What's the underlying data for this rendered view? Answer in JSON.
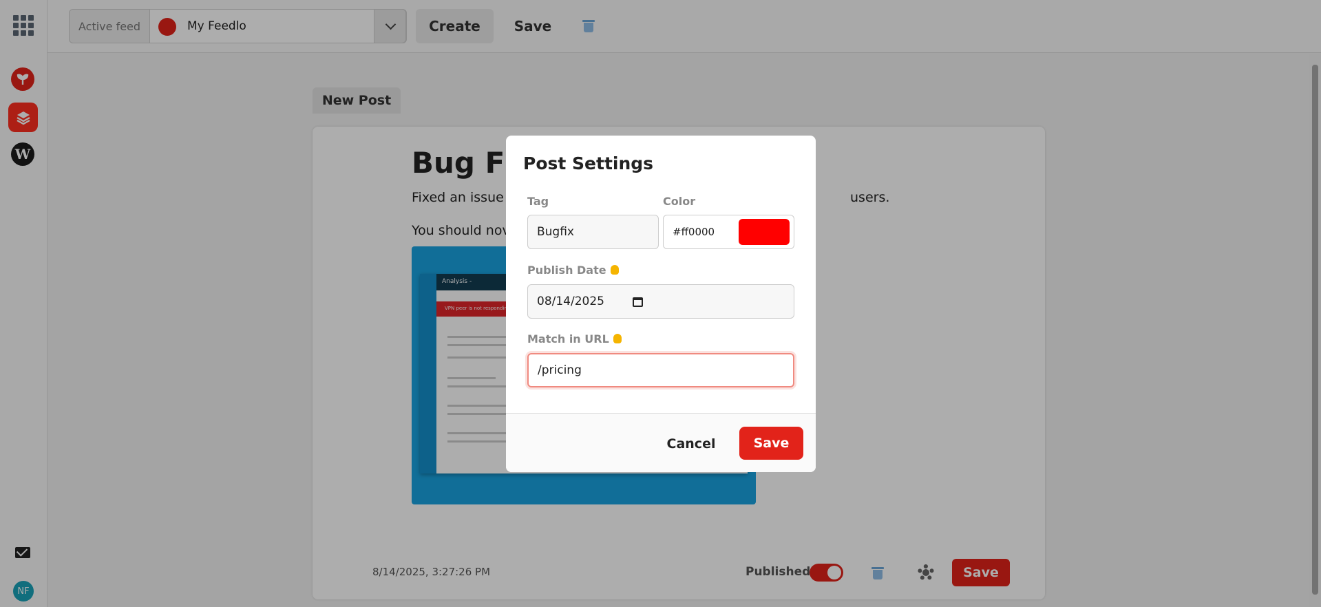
{
  "sidebar": {
    "apps": [
      {
        "name": "sprout-app",
        "color": "#e2231a"
      },
      {
        "name": "feedlo-app",
        "color": "#ff2f1f"
      },
      {
        "name": "wordpress-app",
        "letter": "W",
        "color": "#1b1b1b"
      }
    ],
    "avatar_initials": "NF"
  },
  "topbar": {
    "feed_label": "Active feed",
    "feed_value": "My Feedlo",
    "create_label": "Create",
    "save_label": "Save"
  },
  "post": {
    "tab_label": "New Post",
    "title": "Bug Fi",
    "paragraph1_start": "Fixed an issue",
    "paragraph1_end": "users.",
    "paragraph2": "You should nov",
    "timestamp": "8/14/2025, 3:27:26 PM",
    "published_label": "Published",
    "published": true,
    "save_label": "Save",
    "image": {
      "header_text": "Analysis -",
      "alert_text": "VPN peer is not responding or lo"
    }
  },
  "modal": {
    "title": "Post Settings",
    "tag_label": "Tag",
    "tag_value": "Bugfix",
    "color_label": "Color",
    "color_value": "#ff0000",
    "publish_date_label": "Publish Date",
    "publish_date_value": "08/14/2025",
    "match_url_label": "Match in URL",
    "match_url_value": "/pricing",
    "cancel_label": "Cancel",
    "save_label": "Save"
  },
  "colors": {
    "accent": "#e2231a",
    "overlay": "rgba(0,0,0,0.32)"
  }
}
